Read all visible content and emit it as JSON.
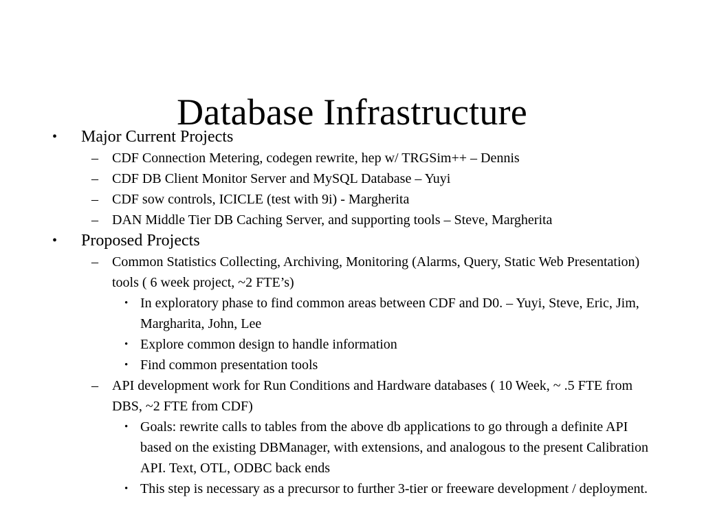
{
  "slide": {
    "title": "Database Infrastructure",
    "background_color": "#ffffff",
    "text_color": "#000000",
    "markers": {
      "level1": "•",
      "level2": "–",
      "level3": "•"
    },
    "content": [
      {
        "level": 1,
        "id": "major-current-projects",
        "text": "Major Current Projects"
      },
      {
        "level": 2,
        "id": "cdf-connection-metering",
        "text": "CDF Connection Metering, codegen rewrite, hep w/ TRGSim++  – Dennis"
      },
      {
        "level": 2,
        "id": "cdf-db-client-monitor",
        "text": "CDF DB Client Monitor Server and MySQL Database – Yuyi"
      },
      {
        "level": 2,
        "id": "cdf-sow-controls",
        "text": "CDF sow controls, ICICLE (test with 9i) - Margherita"
      },
      {
        "level": 2,
        "id": "dan-middle-tier",
        "text": "DAN Middle Tier DB Caching Server, and supporting tools – Steve, Margherita"
      },
      {
        "level": 1,
        "id": "proposed-projects",
        "text": "Proposed Projects"
      },
      {
        "level": 2,
        "id": "common-statistics-collecting",
        "text": "Common Statistics Collecting, Archiving, Monitoring (Alarms, Query, Static Web Presentation) tools ( 6 week project, ~2 FTE’s)"
      },
      {
        "level": 3,
        "id": "exploratory-phase",
        "text": "In exploratory phase to find common areas between CDF and D0. – Yuyi, Steve, Eric, Jim, Margharita, John, Lee"
      },
      {
        "level": 3,
        "id": "explore-common-design",
        "text": "Explore common design to handle information"
      },
      {
        "level": 3,
        "id": "find-common-presentation-tools",
        "text": "Find common presentation tools"
      },
      {
        "level": 2,
        "id": "api-development-work",
        "text": "API development work for Run Conditions and Hardware databases ( 10 Week, ~ .5 FTE from DBS, ~2 FTE from CDF)"
      },
      {
        "level": 3,
        "id": "goals-rewrite-calls",
        "text": "Goals: rewrite calls to tables from the above db applications to go  through a definite API based on the existing DBManager, with extensions, and analogous to the present Calibration API. Text, OTL, ODBC back ends"
      },
      {
        "level": 3,
        "id": "precursor-step",
        "text": "This step is necessary as a precursor to further 3-tier or freeware development / deployment."
      }
    ]
  }
}
